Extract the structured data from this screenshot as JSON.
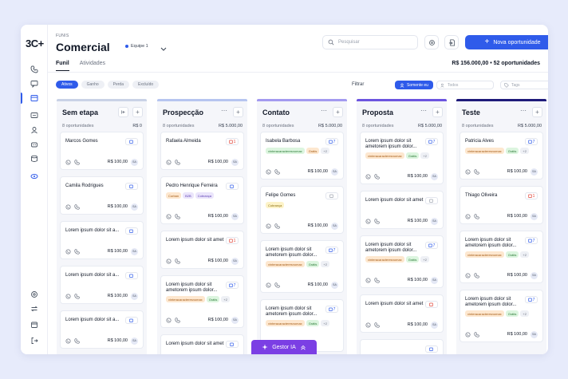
{
  "app": {
    "logo": "3C+",
    "breadcrumb": "FUNIS",
    "title": "Comercial",
    "team": "Equipe 1"
  },
  "search": {
    "placeholder": "Pesquisar"
  },
  "actions": {
    "new_label": "Nova oportunidade"
  },
  "tabs": [
    {
      "label": "Funil",
      "active": true
    },
    {
      "label": "Atividades",
      "active": false
    }
  ],
  "summary": "R$ 156.000,00 • 52 oportunidades",
  "status_chips": [
    {
      "label": "Ativos",
      "active": true
    },
    {
      "label": "Ganho",
      "active": false
    },
    {
      "label": "Perda",
      "active": false
    },
    {
      "label": "Excluído",
      "active": false
    }
  ],
  "filters": {
    "label": "Filtrar",
    "me_button": "Somente eu",
    "users_placeholder": "Todos",
    "tags_placeholder": "Tags"
  },
  "columns": [
    {
      "title": "Sem etapa",
      "count": "8 oportunidades",
      "value": "R$ 0",
      "color": "#c9d2e6",
      "cards": [
        {
          "name": "Marcos Gomes",
          "badge": "",
          "badge_type": "blue",
          "tags": [],
          "amount": "R$ 100,00",
          "avatar": "SA"
        },
        {
          "name": "Camila Rodrigues",
          "badge": "",
          "badge_type": "blue",
          "tags": [],
          "amount": "R$ 100,00",
          "avatar": "SA"
        },
        {
          "name": "Lorem ipsum dolor sit a...",
          "badge": "",
          "badge_type": "blue",
          "tags": [],
          "amount": "R$ 100,00",
          "avatar": "SA"
        },
        {
          "name": "Lorem ipsum dolor sit a...",
          "badge": "",
          "badge_type": "blue",
          "tags": [],
          "amount": "R$ 100,00",
          "avatar": "SA"
        },
        {
          "name": "Lorem ipsum dolor sit a...",
          "badge": "",
          "badge_type": "blue",
          "tags": [],
          "amount": "R$ 100,00",
          "avatar": "SA"
        }
      ]
    },
    {
      "title": "Prospecção",
      "count": "8 oportunidades",
      "value": "R$ 5.000,00",
      "color": "#b6c5f0",
      "cards": [
        {
          "name": "Rafaela Almeida",
          "badge": "1",
          "badge_type": "red",
          "tags": [],
          "amount": "R$ 100,00",
          "avatar": "SA"
        },
        {
          "name": "Pedro Henrique Ferreira",
          "badge": "",
          "badge_type": "blue",
          "tags": [
            {
              "label": "Corban",
              "type": "orange"
            },
            {
              "label": "B2B",
              "type": "purple"
            },
            {
              "label": "Cobrança",
              "type": "purple"
            }
          ],
          "amount": "R$ 100,00",
          "avatar": "SA"
        },
        {
          "name": "Lorem ipsum dolor sit amet",
          "badge": "1",
          "badge_type": "red",
          "tags": [],
          "amount": "R$ 100,00",
          "avatar": "SA"
        },
        {
          "name": "Lorem ipsum dolor sit ametorem ipsum dolor...",
          "badge": "7",
          "badge_type": "blue",
          "tags": [
            {
              "label": "vinteracaracteresnomax",
              "type": "orange"
            },
            {
              "label": "Grátis",
              "type": "green"
            },
            {
              "label": "+2",
              "type": "more"
            }
          ],
          "amount": "R$ 100,00",
          "avatar": "SA"
        },
        {
          "name": "Lorem ipsum dolor sit amet",
          "badge": "",
          "badge_type": "blue",
          "tags": [],
          "amount": "",
          "avatar": ""
        }
      ]
    },
    {
      "title": "Contato",
      "count": "8 oportunidades",
      "value": "R$ 5.000,00",
      "color": "#a39af0",
      "cards": [
        {
          "name": "Isabela Barbosa",
          "badge": "7",
          "badge_type": "blue",
          "tags": [
            {
              "label": "vinteracaracteresnomax",
              "type": "green"
            },
            {
              "label": "Grátis",
              "type": "orange"
            },
            {
              "label": "+2",
              "type": "more"
            }
          ],
          "amount": "R$ 100,00",
          "avatar": "SA"
        },
        {
          "name": "Felipe Gomes",
          "badge": "",
          "badge_type": "gray",
          "tags": [
            {
              "label": "Cobrança",
              "type": "yellow"
            }
          ],
          "amount": "R$ 100,00",
          "avatar": "SA"
        },
        {
          "name": "Lorem ipsum dolor sit ametorem ipsum dolor...",
          "badge": "7",
          "badge_type": "blue",
          "tags": [
            {
              "label": "vinteracaracteresnomax",
              "type": "orange"
            },
            {
              "label": "Grátis",
              "type": "green"
            },
            {
              "label": "+2",
              "type": "more"
            }
          ],
          "amount": "R$ 100,00",
          "avatar": "SA"
        },
        {
          "name": "Lorem ipsum dolor sit ametorem ipsum dolor...",
          "badge": "7",
          "badge_type": "blue",
          "tags": [
            {
              "label": "vinteracaracteresnomax",
              "type": "orange"
            },
            {
              "label": "Grátis",
              "type": "green"
            },
            {
              "label": "+2",
              "type": "more"
            }
          ],
          "amount": "",
          "avatar": ""
        }
      ]
    },
    {
      "title": "Proposta",
      "count": "8 oportunidades",
      "value": "R$ 5.000,00",
      "color": "#6c55df",
      "cards": [
        {
          "name": "Lorem ipsum dolor sit ametorem ipsum dolor...",
          "badge": "7",
          "badge_type": "blue",
          "tags": [
            {
              "label": "vinteracaracteresnomax",
              "type": "orange"
            },
            {
              "label": "Grátis",
              "type": "green"
            },
            {
              "label": "+2",
              "type": "more"
            }
          ],
          "amount": "R$ 100,00",
          "avatar": "SA"
        },
        {
          "name": "Lorem ipsum dolor sit amet",
          "badge": "",
          "badge_type": "gray",
          "tags": [],
          "amount": "R$ 100,00",
          "avatar": "SA"
        },
        {
          "name": "Lorem ipsum dolor sit ametorem ipsum dolor...",
          "badge": "7",
          "badge_type": "blue",
          "tags": [
            {
              "label": "vinteracaracteresnomax",
              "type": "orange"
            },
            {
              "label": "Grátis",
              "type": "green"
            },
            {
              "label": "+2",
              "type": "more"
            }
          ],
          "amount": "R$ 100,00",
          "avatar": "SA"
        },
        {
          "name": "Lorem ipsum dolor sit amet",
          "badge": "",
          "badge_type": "red",
          "tags": [],
          "amount": "R$ 100,00",
          "avatar": "SA"
        },
        {
          "name": "",
          "badge": "",
          "badge_type": "blue",
          "tags": [],
          "amount": "",
          "avatar": ""
        }
      ]
    },
    {
      "title": "Teste",
      "count": "8 oportunidades",
      "value": "R$ 5.000,00",
      "color": "#1f1b7a",
      "cards": [
        {
          "name": "Patricia Alves",
          "badge": "7",
          "badge_type": "blue",
          "tags": [
            {
              "label": "vinteracaracteresnomax",
              "type": "orange"
            },
            {
              "label": "Grátis",
              "type": "green"
            },
            {
              "label": "+2",
              "type": "more"
            }
          ],
          "amount": "R$ 100,00",
          "avatar": "SA"
        },
        {
          "name": "Thiago Oliveira",
          "badge": "1",
          "badge_type": "red",
          "tags": [],
          "amount": "R$ 100,00",
          "avatar": "SA"
        },
        {
          "name": "Lorem ipsum dolor sit ametorem ipsum dolor...",
          "badge": "7",
          "badge_type": "blue",
          "tags": [
            {
              "label": "vinteracaracteresnomax",
              "type": "orange"
            },
            {
              "label": "Grátis",
              "type": "green"
            },
            {
              "label": "+2",
              "type": "more"
            }
          ],
          "amount": "R$ 100,00",
          "avatar": "SA"
        },
        {
          "name": "Lorem ipsum dolor sit ametorem ipsum dolor...",
          "badge": "7",
          "badge_type": "blue",
          "tags": [
            {
              "label": "vinteracaracteresnomax",
              "type": "orange"
            },
            {
              "label": "Grátis",
              "type": "green"
            },
            {
              "label": "+2",
              "type": "more"
            }
          ],
          "amount": "R$ 100,00",
          "avatar": "SA"
        }
      ]
    }
  ],
  "gestor": {
    "label": "Gestor IA"
  },
  "colors": {
    "accent": "#2f5bea",
    "gestor": "#7b3fe4"
  }
}
